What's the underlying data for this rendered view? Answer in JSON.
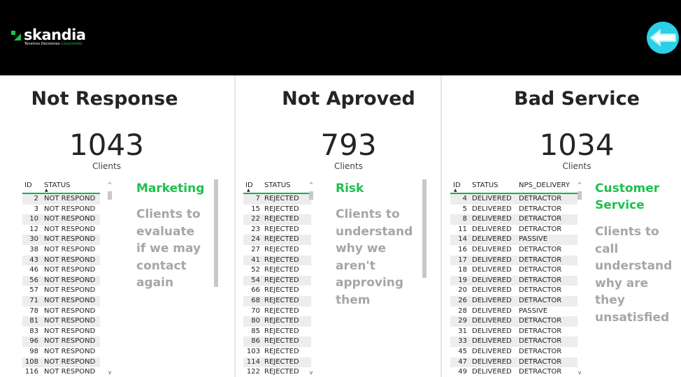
{
  "header": {
    "logo_text": "skandia",
    "logo_tagline": "Tenemos Decisiones",
    "logo_tagline_accent": "Conscientes",
    "back_icon": "arrow-left-icon"
  },
  "panels": [
    {
      "title": "Not Response",
      "kpi_value": "1043",
      "kpi_label": "Clients",
      "columns": [
        "ID",
        "STATUS"
      ],
      "rows": [
        [
          "2",
          "NOT RESPOND"
        ],
        [
          "3",
          "NOT RESPOND"
        ],
        [
          "10",
          "NOT RESPOND"
        ],
        [
          "12",
          "NOT RESPOND"
        ],
        [
          "30",
          "NOT RESPOND"
        ],
        [
          "38",
          "NOT RESPOND"
        ],
        [
          "43",
          "NOT RESPOND"
        ],
        [
          "46",
          "NOT RESPOND"
        ],
        [
          "56",
          "NOT RESPOND"
        ],
        [
          "57",
          "NOT RESPOND"
        ],
        [
          "71",
          "NOT RESPOND"
        ],
        [
          "78",
          "NOT RESPOND"
        ],
        [
          "81",
          "NOT RESPOND"
        ],
        [
          "83",
          "NOT RESPOND"
        ],
        [
          "96",
          "NOT RESPOND"
        ],
        [
          "98",
          "NOT RESPOND"
        ],
        [
          "108",
          "NOT RESPOND"
        ],
        [
          "116",
          "NOT RESPOND"
        ]
      ],
      "desc_title": "Marketing",
      "desc_text": "Clients to evaluate if we may contact again"
    },
    {
      "title": "Not Aproved",
      "kpi_value": "793",
      "kpi_label": "Clients",
      "columns": [
        "ID",
        "STATUS"
      ],
      "rows": [
        [
          "7",
          "REJECTED"
        ],
        [
          "15",
          "REJECTED"
        ],
        [
          "22",
          "REJECTED"
        ],
        [
          "23",
          "REJECTED"
        ],
        [
          "24",
          "REJECTED"
        ],
        [
          "27",
          "REJECTED"
        ],
        [
          "41",
          "REJECTED"
        ],
        [
          "52",
          "REJECTED"
        ],
        [
          "54",
          "REJECTED"
        ],
        [
          "66",
          "REJECTED"
        ],
        [
          "68",
          "REJECTED"
        ],
        [
          "70",
          "REJECTED"
        ],
        [
          "80",
          "REJECTED"
        ],
        [
          "85",
          "REJECTED"
        ],
        [
          "86",
          "REJECTED"
        ],
        [
          "103",
          "REJECTED"
        ],
        [
          "114",
          "REJECTED"
        ],
        [
          "122",
          "REJECTED"
        ]
      ],
      "desc_title": "Risk",
      "desc_text": "Clients to understand why we aren't approving them"
    },
    {
      "title": "Bad Service",
      "kpi_value": "1034",
      "kpi_label": "Clients",
      "columns": [
        "ID",
        "STATUS",
        "NPS_DELIVERY"
      ],
      "rows": [
        [
          "4",
          "DELIVERED",
          "DETRACTOR"
        ],
        [
          "5",
          "DELIVERED",
          "DETRACTOR"
        ],
        [
          "8",
          "DELIVERED",
          "DETRACTOR"
        ],
        [
          "11",
          "DELIVERED",
          "DETRACTOR"
        ],
        [
          "14",
          "DELIVERED",
          "PASSIVE"
        ],
        [
          "16",
          "DELIVERED",
          "DETRACTOR"
        ],
        [
          "17",
          "DELIVERED",
          "DETRACTOR"
        ],
        [
          "18",
          "DELIVERED",
          "DETRACTOR"
        ],
        [
          "19",
          "DELIVERED",
          "DETRACTOR"
        ],
        [
          "20",
          "DELIVERED",
          "DETRACTOR"
        ],
        [
          "26",
          "DELIVERED",
          "DETRACTOR"
        ],
        [
          "28",
          "DELIVERED",
          "PASSIVE"
        ],
        [
          "29",
          "DELIVERED",
          "DETRACTOR"
        ],
        [
          "31",
          "DELIVERED",
          "DETRACTOR"
        ],
        [
          "33",
          "DELIVERED",
          "DETRACTOR"
        ],
        [
          "45",
          "DELIVERED",
          "DETRACTOR"
        ],
        [
          "47",
          "DELIVERED",
          "DETRACTOR"
        ],
        [
          "49",
          "DELIVERED",
          "DETRACTOR"
        ]
      ],
      "desc_title": "Customer Service",
      "desc_text": "Clients to call understand why are they unsatisfied"
    }
  ]
}
